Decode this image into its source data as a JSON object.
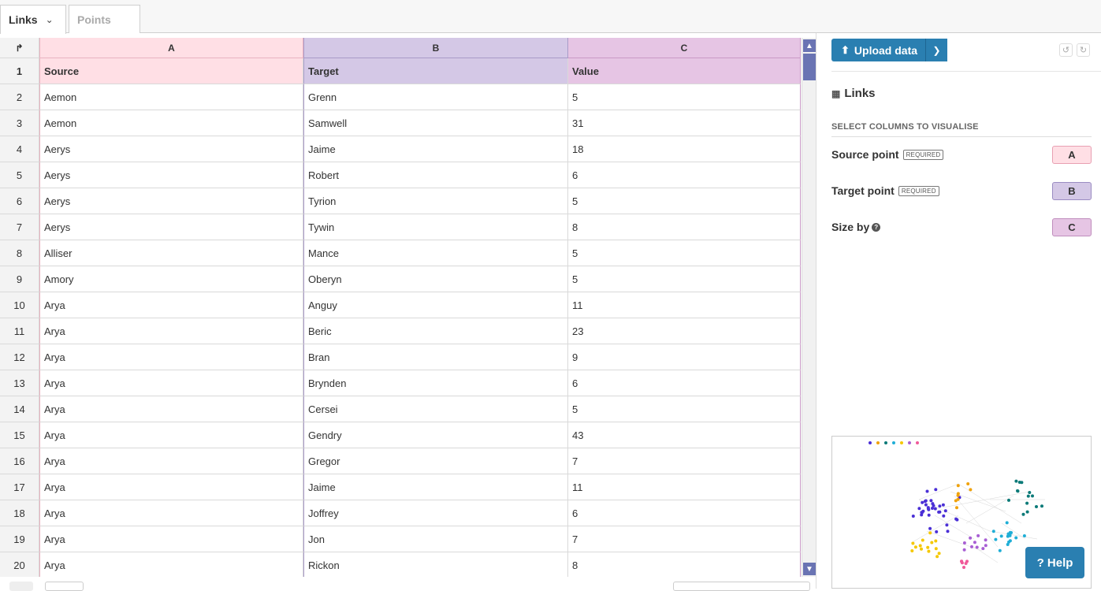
{
  "tabs": [
    {
      "label": "Links",
      "active": true
    },
    {
      "label": "Points",
      "active": false
    }
  ],
  "grid": {
    "corner_icon": "transpose-icon",
    "columns": [
      "A",
      "B",
      "C"
    ],
    "rows": [
      {
        "n": "1",
        "a": "Source",
        "b": "Target",
        "c": "Value"
      },
      {
        "n": "2",
        "a": "Aemon",
        "b": "Grenn",
        "c": "5"
      },
      {
        "n": "3",
        "a": "Aemon",
        "b": "Samwell",
        "c": "31"
      },
      {
        "n": "4",
        "a": "Aerys",
        "b": "Jaime",
        "c": "18"
      },
      {
        "n": "5",
        "a": "Aerys",
        "b": "Robert",
        "c": "6"
      },
      {
        "n": "6",
        "a": "Aerys",
        "b": "Tyrion",
        "c": "5"
      },
      {
        "n": "7",
        "a": "Aerys",
        "b": "Tywin",
        "c": "8"
      },
      {
        "n": "8",
        "a": "Alliser",
        "b": "Mance",
        "c": "5"
      },
      {
        "n": "9",
        "a": "Amory",
        "b": "Oberyn",
        "c": "5"
      },
      {
        "n": "10",
        "a": "Arya",
        "b": "Anguy",
        "c": "11"
      },
      {
        "n": "11",
        "a": "Arya",
        "b": "Beric",
        "c": "23"
      },
      {
        "n": "12",
        "a": "Arya",
        "b": "Bran",
        "c": "9"
      },
      {
        "n": "13",
        "a": "Arya",
        "b": "Brynden",
        "c": "6"
      },
      {
        "n": "14",
        "a": "Arya",
        "b": "Cersei",
        "c": "5"
      },
      {
        "n": "15",
        "a": "Arya",
        "b": "Gendry",
        "c": "43"
      },
      {
        "n": "16",
        "a": "Arya",
        "b": "Gregor",
        "c": "7"
      },
      {
        "n": "17",
        "a": "Arya",
        "b": "Jaime",
        "c": "11"
      },
      {
        "n": "18",
        "a": "Arya",
        "b": "Joffrey",
        "c": "6"
      },
      {
        "n": "19",
        "a": "Arya",
        "b": "Jon",
        "c": "7"
      },
      {
        "n": "20",
        "a": "Arya",
        "b": "Rickon",
        "c": "8"
      }
    ]
  },
  "panel": {
    "upload_label": "Upload data",
    "dataset_title": "Links",
    "section_label": "SELECT COLUMNS TO VISUALISE",
    "options": [
      {
        "label": "Source point",
        "badge": "REQUIRED",
        "column": "A"
      },
      {
        "label": "Target point",
        "badge": "REQUIRED",
        "column": "B"
      },
      {
        "label": "Size by",
        "badge": "",
        "column": "C"
      }
    ],
    "help_label": "? Help"
  },
  "colors": {
    "accent": "#2a7fb1",
    "col_a": "#ffdfe5",
    "col_b": "#d4c8e6",
    "col_c": "#e6c5e4",
    "scroll": "#6a74b3"
  }
}
